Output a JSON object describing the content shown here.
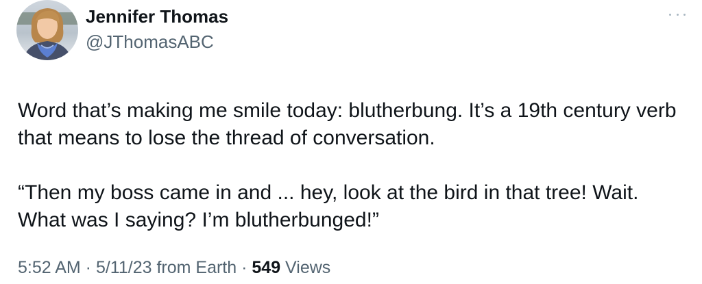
{
  "author": {
    "display_name": "Jennifer Thomas",
    "handle": "@JThomasABC",
    "avatar_icon": "profile-photo-avatar"
  },
  "more_icon": "ellipsis-icon",
  "tweet": {
    "line1": "Word that’s making me smile today: blutherbung. It’s a 19th century verb",
    "line2": "that means to lose the thread of conversation.",
    "line3": "“Then my boss came in and ... hey, look at the bird in that tree! Wait.",
    "line4": "What was I saying? I’m blutherbunged!”"
  },
  "meta": {
    "time": "5:52 AM",
    "sep1": " · ",
    "date": "5/11/23",
    "source": " from Earth",
    "sep2": " · ",
    "views_count": "549",
    "views_label": " Views"
  },
  "colors": {
    "text_primary": "#0f1419",
    "text_secondary": "#536471",
    "more_dots": "#aab8c2"
  }
}
